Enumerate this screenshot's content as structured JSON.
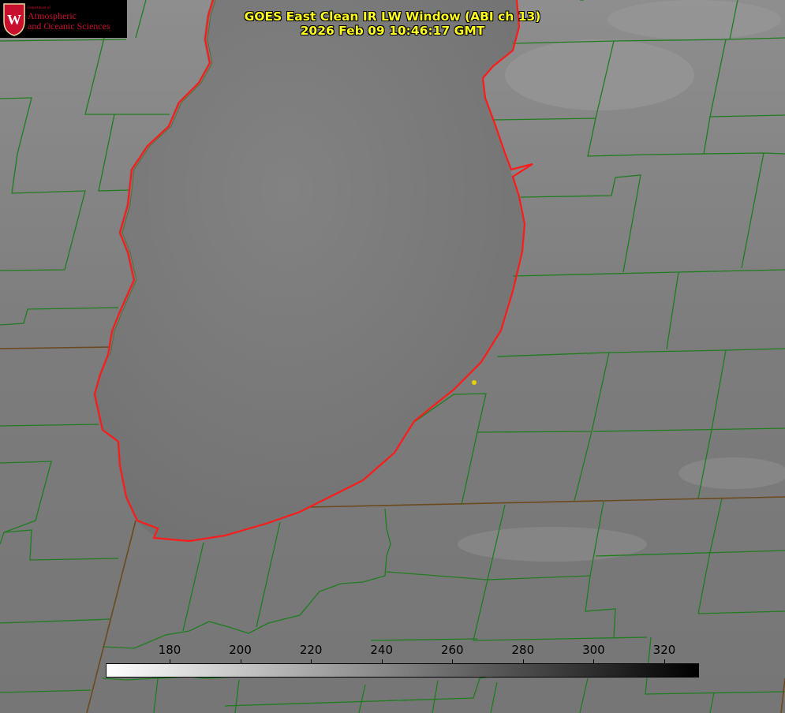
{
  "title": {
    "line1": "GOES East Clean IR LW Window (ABI ch 13)",
    "line2": "2026 Feb 09 10:46:17 GMT"
  },
  "logo": {
    "line_small": "Department of",
    "line1": "Atmospheric",
    "line2": "and Oceanic Sciences",
    "crest_letter": "W"
  },
  "colorbar": {
    "tick_labels": [
      "180",
      "200",
      "220",
      "240",
      "260",
      "280",
      "300",
      "320"
    ],
    "min_label_value": 180,
    "max_label_value": 320,
    "colormap": "white (cold) to black (warm)"
  },
  "colors": {
    "county_lines": "#1e7d1e",
    "shoreline": "#ff1a1a",
    "marker": "#e6d200",
    "title": "#ffff1e",
    "logo_text": "#c8102e"
  }
}
